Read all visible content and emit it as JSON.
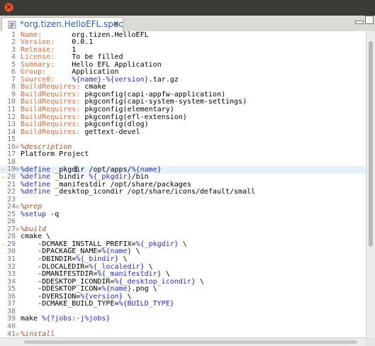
{
  "window": {
    "close_glyph": "×"
  },
  "tab": {
    "title": "*org.tizen.HelloEFL.spec",
    "close_glyph": "✕",
    "icon": "spec-file-icon"
  },
  "editor": {
    "highlighted_line": 19,
    "caret_line": 19,
    "lines": [
      {
        "n": "1",
        "tokens": [
          {
            "t": "Name:",
            "c": "tag"
          },
          {
            "t": "       org.tizen.HelloEFL"
          }
        ]
      },
      {
        "n": "2",
        "tokens": [
          {
            "t": "Version:",
            "c": "tag"
          },
          {
            "t": "    0.0.1"
          }
        ]
      },
      {
        "n": "3",
        "tokens": [
          {
            "t": "Release:",
            "c": "tag"
          },
          {
            "t": "    1"
          }
        ]
      },
      {
        "n": "4",
        "tokens": [
          {
            "t": "License:",
            "c": "tag"
          },
          {
            "t": "    To be filled"
          }
        ]
      },
      {
        "n": "5",
        "tokens": [
          {
            "t": "Summary:",
            "c": "tag"
          },
          {
            "t": "    Hello EFL Application"
          }
        ]
      },
      {
        "n": "6",
        "tokens": [
          {
            "t": "Group:",
            "c": "tag"
          },
          {
            "t": "      Application"
          }
        ]
      },
      {
        "n": "7",
        "tokens": [
          {
            "t": "Source0:",
            "c": "tag"
          },
          {
            "t": "    "
          },
          {
            "t": "%{name}",
            "c": "macro"
          },
          {
            "t": "-"
          },
          {
            "t": "%{version}",
            "c": "macro"
          },
          {
            "t": ".tar.gz"
          }
        ]
      },
      {
        "n": "8",
        "tokens": [
          {
            "t": "BuildRequires:",
            "c": "tag"
          },
          {
            "t": " cmake"
          }
        ]
      },
      {
        "n": "9",
        "tokens": [
          {
            "t": "BuildRequires:",
            "c": "tag"
          },
          {
            "t": " pkgconfig(capi-appfw-application)"
          }
        ]
      },
      {
        "n": "10",
        "tokens": [
          {
            "t": "BuildRequires:",
            "c": "tag"
          },
          {
            "t": " pkgconfig(capi-system-system-settings)"
          }
        ]
      },
      {
        "n": "11",
        "tokens": [
          {
            "t": "BuildRequires:",
            "c": "tag"
          },
          {
            "t": " pkgconfig(elementary)"
          }
        ]
      },
      {
        "n": "12",
        "tokens": [
          {
            "t": "BuildRequires:",
            "c": "tag"
          },
          {
            "t": " pkgconfig(efl-extension)"
          }
        ]
      },
      {
        "n": "13",
        "tokens": [
          {
            "t": "BuildRequires:",
            "c": "tag"
          },
          {
            "t": " pkgconfig(dlog)"
          }
        ]
      },
      {
        "n": "14",
        "tokens": [
          {
            "t": "BuildRequires:",
            "c": "tag"
          },
          {
            "t": " gettext-devel"
          }
        ]
      },
      {
        "n": "15",
        "tokens": []
      },
      {
        "n": "16",
        "fold": true,
        "tokens": [
          {
            "t": "%description",
            "c": "sec"
          }
        ]
      },
      {
        "n": "17",
        "tokens": [
          {
            "t": "Platform Project"
          }
        ]
      },
      {
        "n": "18",
        "tokens": []
      },
      {
        "n": "19",
        "marker": true,
        "fold": true,
        "caret_after": 1,
        "tokens": [
          {
            "t": "%define",
            "c": "macro"
          },
          {
            "t": " _pkgd"
          },
          {
            "t": "ir /opt/apps/"
          },
          {
            "t": "%{name}",
            "c": "macro"
          }
        ]
      },
      {
        "n": "20",
        "marker": true,
        "tokens": [
          {
            "t": "%define",
            "c": "macro"
          },
          {
            "t": " _bindir "
          },
          {
            "t": "%{_pkgdir}",
            "c": "macro"
          },
          {
            "t": "/bin"
          }
        ]
      },
      {
        "n": "21",
        "tokens": [
          {
            "t": "%define",
            "c": "macro"
          },
          {
            "t": " _manifestdir /opt/share/packages"
          }
        ]
      },
      {
        "n": "22",
        "tokens": [
          {
            "t": "%define",
            "c": "macro"
          },
          {
            "t": " _desktop_icondir /opt/share/icons/default/small"
          }
        ]
      },
      {
        "n": "23",
        "tokens": []
      },
      {
        "n": "24",
        "fold": true,
        "tokens": [
          {
            "t": "%prep",
            "c": "sec"
          }
        ]
      },
      {
        "n": "25",
        "tokens": [
          {
            "t": "%setup",
            "c": "macro"
          },
          {
            "t": " -q"
          }
        ]
      },
      {
        "n": "26",
        "tokens": []
      },
      {
        "n": "27",
        "fold": true,
        "tokens": [
          {
            "t": "%build",
            "c": "sec"
          }
        ]
      },
      {
        "n": "28",
        "tokens": [
          {
            "t": "cmake \\"
          }
        ]
      },
      {
        "n": "29",
        "marker": true,
        "tokens": [
          {
            "t": "    -DCMAKE_INSTALL_PREFIX="
          },
          {
            "t": "%{_pkgdir}",
            "c": "macro"
          },
          {
            "t": " \\"
          }
        ]
      },
      {
        "n": "30",
        "tokens": [
          {
            "t": "    -DPACKAGE_NAME="
          },
          {
            "t": "%{name}",
            "c": "macro"
          },
          {
            "t": " \\"
          }
        ]
      },
      {
        "n": "31",
        "tokens": [
          {
            "t": "    -DBINDIR="
          },
          {
            "t": "%{_bindir}",
            "c": "macro"
          },
          {
            "t": " \\"
          }
        ]
      },
      {
        "n": "32",
        "tokens": [
          {
            "t": "    -DLOCALEDIR="
          },
          {
            "t": "%{_localedir}",
            "c": "macro"
          },
          {
            "t": " \\"
          }
        ]
      },
      {
        "n": "33",
        "tokens": [
          {
            "t": "    -DMANIFESTDIR="
          },
          {
            "t": "%{_manifestdir}",
            "c": "macro"
          },
          {
            "t": " \\"
          }
        ]
      },
      {
        "n": "34",
        "tokens": [
          {
            "t": "    -DDESKTOP_ICONDIR="
          },
          {
            "t": "%{_desktop_icondir}",
            "c": "macro"
          },
          {
            "t": " \\"
          }
        ]
      },
      {
        "n": "35",
        "tokens": [
          {
            "t": "    -DDESKTOP_ICON="
          },
          {
            "t": "%{name}",
            "c": "macro"
          },
          {
            "t": ".png \\"
          }
        ]
      },
      {
        "n": "36",
        "tokens": [
          {
            "t": "    -DVERSION="
          },
          {
            "t": "%{version}",
            "c": "macro"
          },
          {
            "t": " \\"
          }
        ]
      },
      {
        "n": "37",
        "tokens": [
          {
            "t": "    -DCMAKE_BUILD_TYPE="
          },
          {
            "t": "%{BUILD_TYPE}",
            "c": "macro"
          }
        ]
      },
      {
        "n": "38",
        "tokens": []
      },
      {
        "n": "39",
        "tokens": [
          {
            "t": "make "
          },
          {
            "t": "%{?jobs:-j%jobs}",
            "c": "macro"
          }
        ]
      },
      {
        "n": "40",
        "tokens": []
      },
      {
        "n": "41",
        "fold": true,
        "tokens": [
          {
            "t": "%install",
            "c": "sec"
          }
        ]
      }
    ]
  },
  "colors": {
    "tag": "#d46a3a",
    "macro": "#2a2ab0",
    "section": "#a0522d",
    "current_line": "#e8f2fe",
    "line_number": "#787878",
    "tab_title": "#2a5db0"
  }
}
